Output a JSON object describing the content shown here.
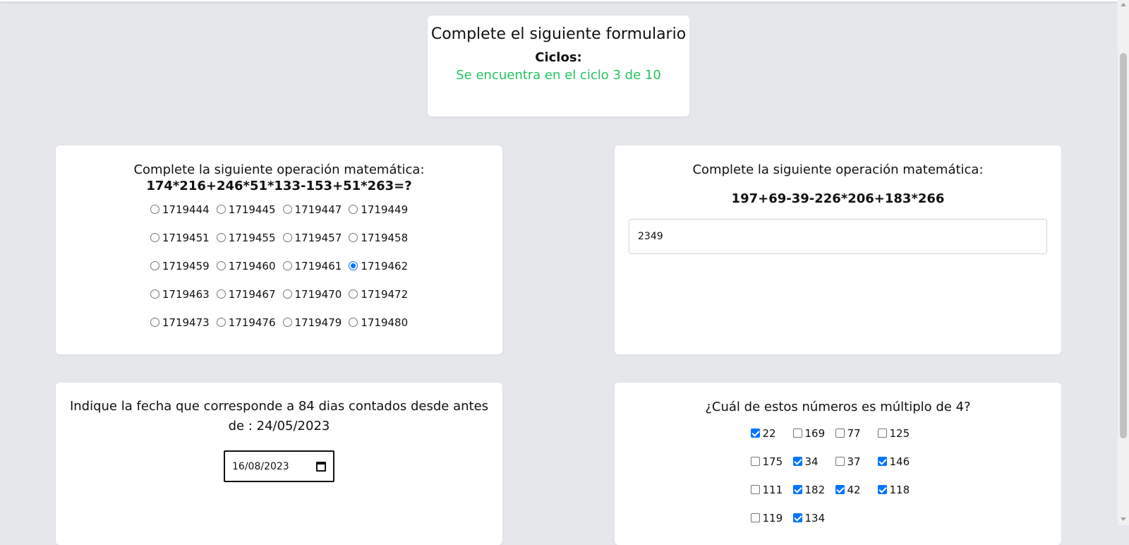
{
  "header": {
    "title": "Complete el siguiente formulario",
    "cycles_label": "Ciclos:",
    "cycles_status": "Se encuentra en el ciclo 3 de 10"
  },
  "question1": {
    "title": "Complete la siguiente operación matemática:",
    "expression": "174*216+246*51*133-153+51*263=?",
    "options": [
      "1719444",
      "1719445",
      "1719447",
      "1719449",
      "1719451",
      "1719455",
      "1719457",
      "1719458",
      "1719459",
      "1719460",
      "1719461",
      "1719462",
      "1719463",
      "1719467",
      "1719470",
      "1719472",
      "1719473",
      "1719476",
      "1719479",
      "1719480"
    ],
    "selected": "1719462"
  },
  "question2": {
    "title": "Complete la siguiente operación matemática:",
    "expression": "197+69-39-226*206+183*266",
    "input_value": "2349"
  },
  "question3": {
    "title": "Indique la fecha que corresponde a 84 dias contados desde antes de : 24/05/2023",
    "date_value": "16/08/2023"
  },
  "question4": {
    "title": "¿Cuál de estos números es múltiplo de 4?",
    "options": [
      {
        "label": "22",
        "checked": true
      },
      {
        "label": "169",
        "checked": false
      },
      {
        "label": "77",
        "checked": false
      },
      {
        "label": "125",
        "checked": false
      },
      {
        "label": "175",
        "checked": false
      },
      {
        "label": "34",
        "checked": true
      },
      {
        "label": "37",
        "checked": false
      },
      {
        "label": "146",
        "checked": true
      },
      {
        "label": "111",
        "checked": false
      },
      {
        "label": "182",
        "checked": true
      },
      {
        "label": "42",
        "checked": true
      },
      {
        "label": "118",
        "checked": true
      },
      {
        "label": "119",
        "checked": false
      },
      {
        "label": "134",
        "checked": true
      }
    ]
  },
  "colors": {
    "status_green": "#22c55e",
    "accent_blue": "#0075ff",
    "page_bg": "#e5e7eb"
  }
}
